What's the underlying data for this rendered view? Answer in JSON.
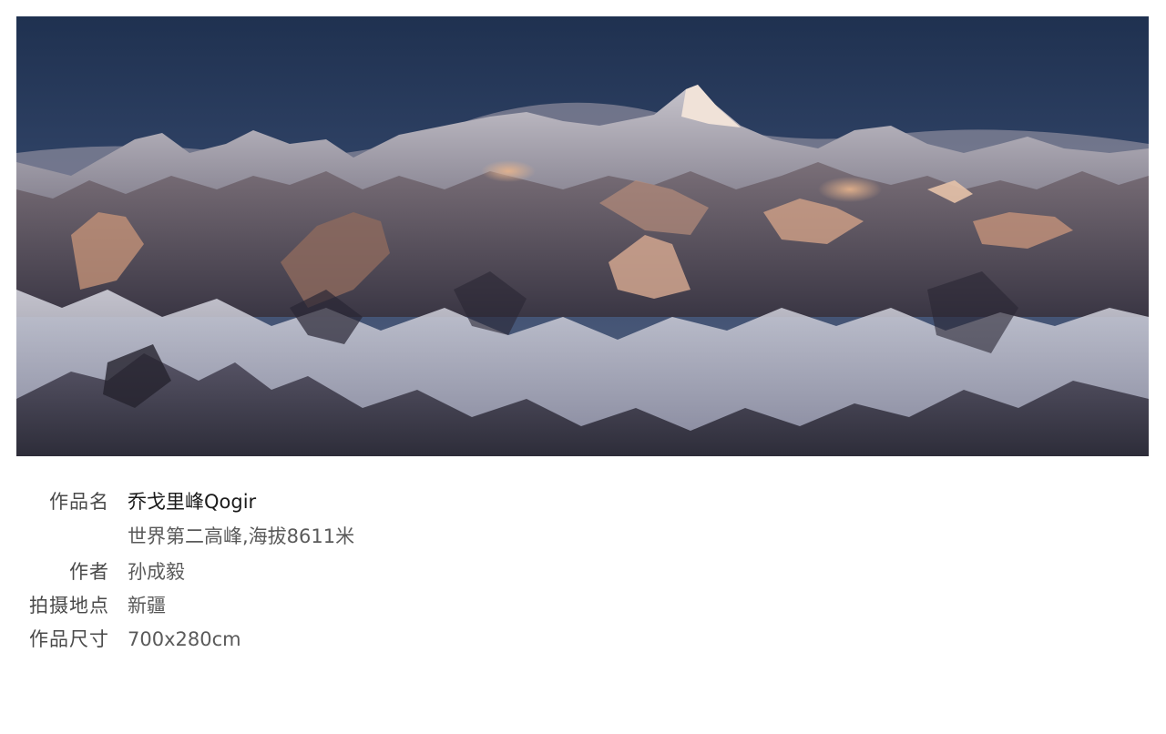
{
  "artwork": {
    "title_label": "作品名",
    "title": "乔戈里峰Qogir",
    "subtitle": "世界第二高峰,海拔8611米",
    "author_label": "作者",
    "author": "孙成毅",
    "location_label": "拍摄地点",
    "location": "新疆",
    "size_label": "作品尺寸",
    "size": "700x280cm"
  }
}
